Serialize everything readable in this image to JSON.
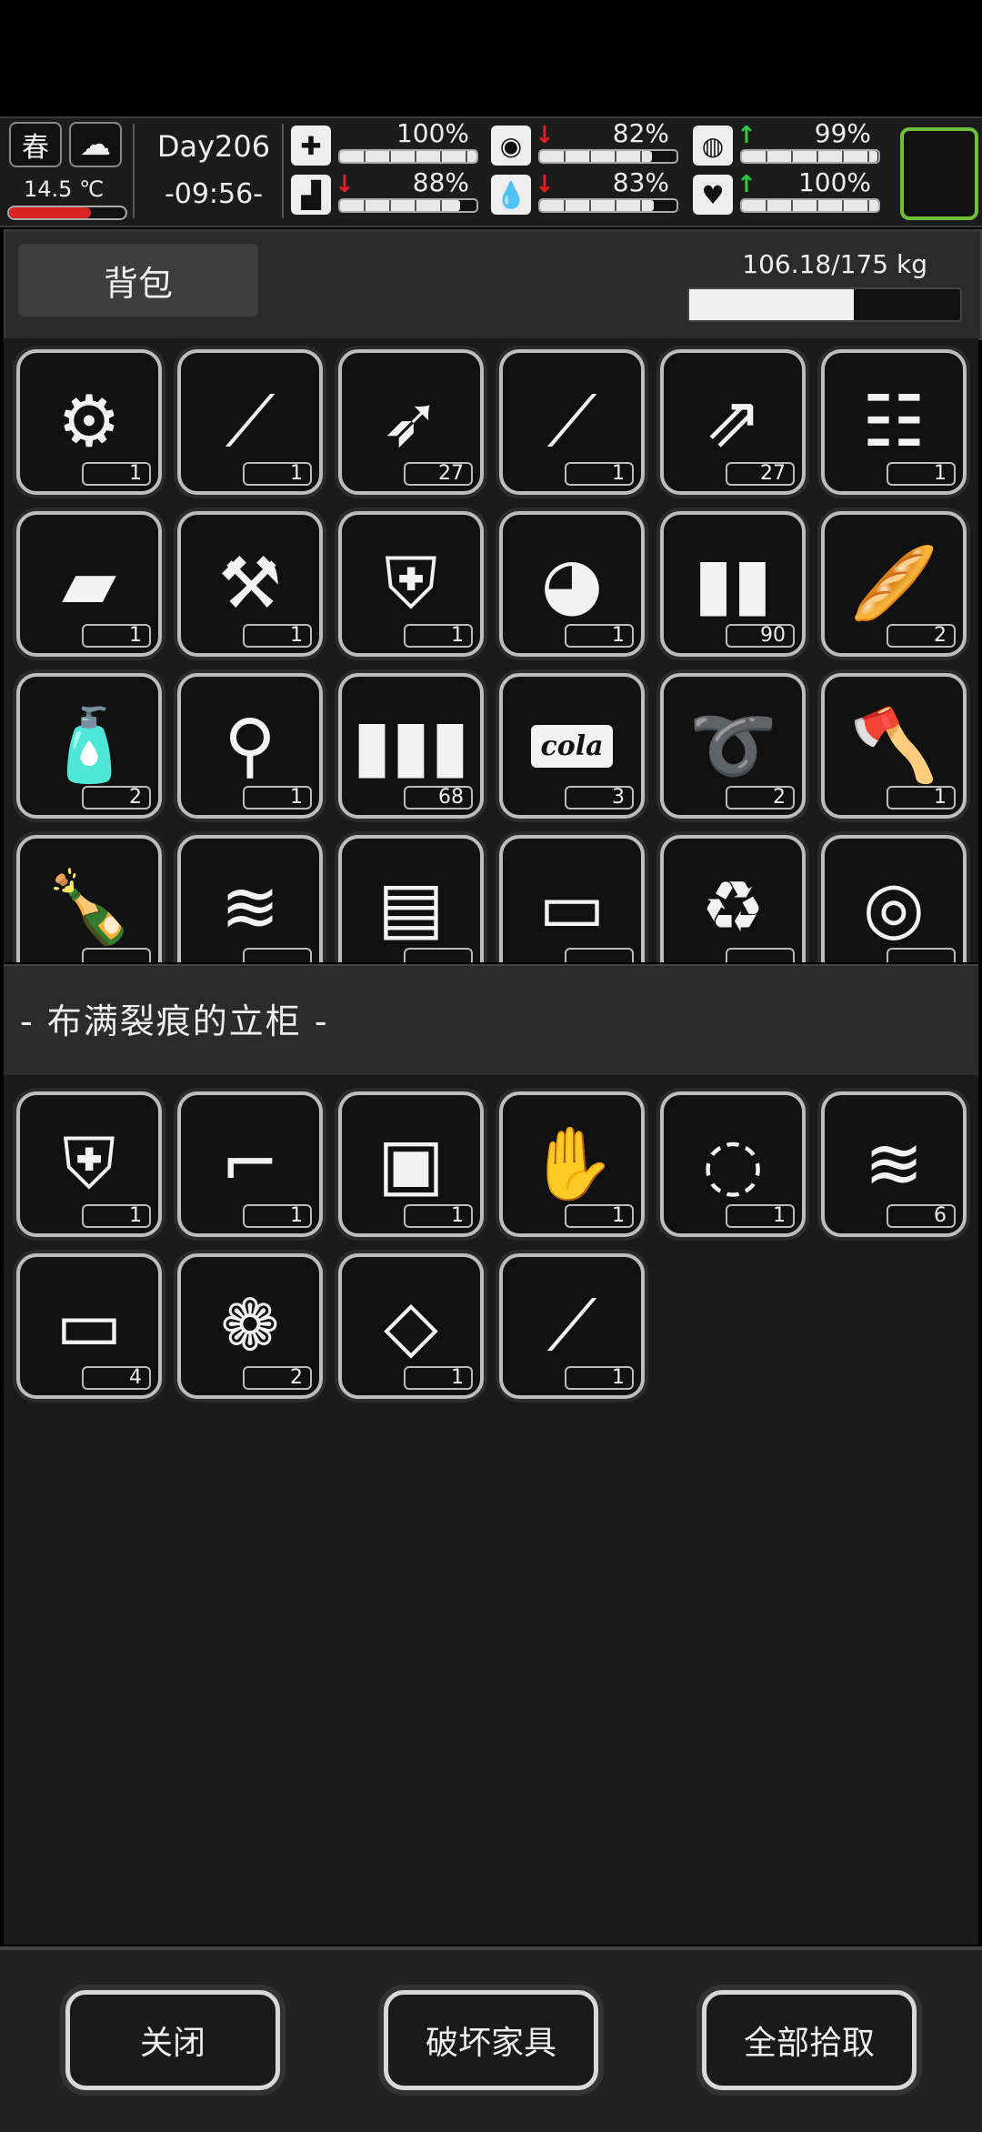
{
  "status": {
    "season": "春",
    "weather_icon": "cloud-icon",
    "temperature": "14.5 ℃",
    "day": "Day206",
    "time": "-09:56-",
    "stats": [
      {
        "name": "health",
        "icon": "medkit-icon",
        "arrow": "",
        "percent": "100%",
        "level": 1.0
      },
      {
        "name": "hunger",
        "icon": "stomach-icon",
        "arrow": "down",
        "percent": "82%",
        "level": 0.82
      },
      {
        "name": "sanity",
        "icon": "brain-icon",
        "arrow": "up",
        "percent": "99%",
        "level": 0.99
      },
      {
        "name": "stamina",
        "icon": "boot-icon",
        "arrow": "down",
        "percent": "88%",
        "level": 0.88
      },
      {
        "name": "thirst",
        "icon": "water-drop-icon",
        "arrow": "down",
        "percent": "83%",
        "level": 0.83
      },
      {
        "name": "mood",
        "icon": "heart-icon",
        "arrow": "up",
        "percent": "100%",
        "level": 1.0
      }
    ]
  },
  "backpack": {
    "tab_label": "背包",
    "weight": "106.18/175 kg",
    "weight_fraction": 0.607,
    "items": [
      {
        "icon": "machine-part-icon",
        "count": "1"
      },
      {
        "icon": "rocket-launcher-icon",
        "count": "1"
      },
      {
        "icon": "rocket-ammo-icon",
        "count": "27"
      },
      {
        "icon": "sniper-rifle-icon",
        "count": "1"
      },
      {
        "icon": "rifle-bullets-icon",
        "count": "27"
      },
      {
        "icon": "minigun-icon",
        "count": "1"
      },
      {
        "icon": "battery-pack-icon",
        "count": "1"
      },
      {
        "icon": "mechanical-parts-icon",
        "count": "1"
      },
      {
        "icon": "armor-chestplate-icon",
        "count": "1"
      },
      {
        "icon": "combat-helmet-icon",
        "count": "1"
      },
      {
        "icon": "pistol-bullets-icon",
        "count": "90"
      },
      {
        "icon": "bread-icon",
        "count": "2"
      },
      {
        "icon": "water-bottle-icon",
        "count": "2"
      },
      {
        "icon": "shovel-icon",
        "count": "1"
      },
      {
        "icon": "bullets-icon",
        "count": "68"
      },
      {
        "icon": "cola-cup-icon",
        "count": "3",
        "label": "cola"
      },
      {
        "icon": "rope-icon",
        "count": "2"
      },
      {
        "icon": "axe-icon",
        "count": "1"
      },
      {
        "icon": "liquor-bottle-icon",
        "count": ""
      },
      {
        "icon": "cloth-scraps-icon",
        "count": ""
      },
      {
        "icon": "wood-planks-icon",
        "count": ""
      },
      {
        "icon": "wooden-board-icon",
        "count": ""
      },
      {
        "icon": "trash-icon",
        "count": ""
      },
      {
        "icon": "logs-icon",
        "count": ""
      }
    ]
  },
  "container": {
    "title": "- 布满裂痕的立柜 -",
    "items": [
      {
        "icon": "body-armor-icon",
        "count": "1"
      },
      {
        "icon": "revolver-icon",
        "count": "1"
      },
      {
        "icon": "jerrycan-icon",
        "count": "1"
      },
      {
        "icon": "gloves-icon",
        "count": "1"
      },
      {
        "icon": "tape-roll-icon",
        "count": "1"
      },
      {
        "icon": "cloth-scraps-icon",
        "count": "6"
      },
      {
        "icon": "wooden-board-icon",
        "count": "4"
      },
      {
        "icon": "cotton-icon",
        "count": "2"
      },
      {
        "icon": "glass-shards-icon",
        "count": "1"
      },
      {
        "icon": "lockpick-icon",
        "count": "1"
      }
    ]
  },
  "buttons": {
    "close": "关闭",
    "destroy": "破坏家具",
    "take_all": "全部拾取"
  }
}
